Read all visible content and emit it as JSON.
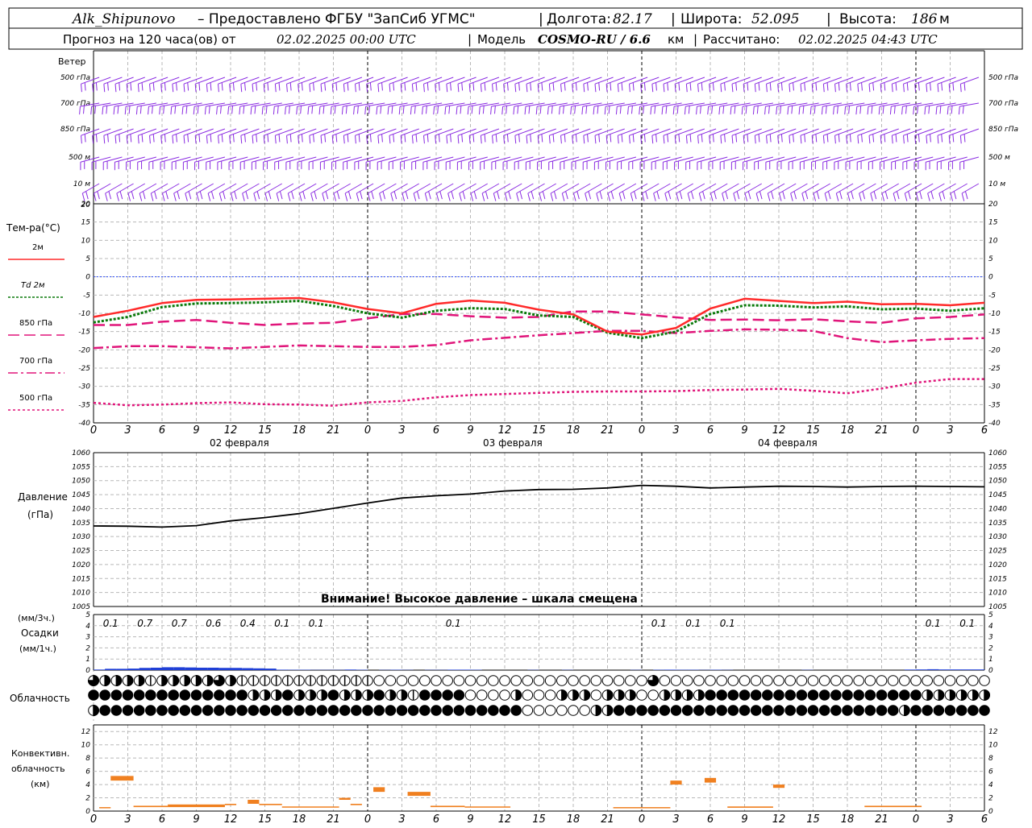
{
  "header": {
    "station": "Alk_Shipunovo",
    "provider": "– Предоставлено ФГБУ \"ЗапСиб УГМС\"",
    "lon_label": "Долгота:",
    "lon_value": "82.17",
    "lat_label": "Широта:",
    "lat_value": "52.095",
    "alt_label": "Высота:",
    "alt_value": "186",
    "alt_unit": "м",
    "forecast_label": "Прогноз на 120 часа(ов) от",
    "forecast_from": "02.02.2025 00:00 UTC",
    "model_label": "Модель",
    "model_name": "COSMO-RU / 6.6",
    "model_unit": "км",
    "calc_label": "Рассчитано:",
    "calc_time": "02.02.2025 04:43 UTC"
  },
  "labels": {
    "wind": "Ветер",
    "wind_levels": [
      "500 гПа",
      "700 гПа",
      "850 гПа",
      "500 м",
      "10   м"
    ],
    "temp_title": "Тем-ра(°С)",
    "temp_legend": [
      "2м",
      "Td  2м",
      "850 гПа",
      "700 гПа",
      "500 гПа"
    ],
    "pressure_title": "Давление",
    "pressure_unit": "(гПа)",
    "pressure_warning": "Внимание! Высокое давление – шкала смещена",
    "precip_unit3": "(мм/3ч.)",
    "precip_title": "Осадки",
    "precip_unit1": "(мм/1ч.)",
    "cloud_title": "Облачность",
    "conv_title1": "Конвективн.",
    "conv_title2": "облачность",
    "conv_unit": "(км)",
    "dates": [
      "02 февраля",
      "03 февраля",
      "04 февраля"
    ]
  },
  "colors": {
    "t2m": "#ff2a2a",
    "td2m": "#0a7a0a",
    "p850": "#e0157a",
    "p700": "#e0157a",
    "p500": "#e0157a",
    "wind": "#8a2be2",
    "precip": "#1f3fd6",
    "conv": "#f08020",
    "pressure": "#000000",
    "zero": "#3050ff"
  },
  "chart_data": [
    {
      "type": "line",
      "name": "temperature",
      "x_hours": [
        0,
        3,
        6,
        9,
        12,
        15,
        18,
        21,
        24,
        27,
        30,
        33,
        36,
        39,
        42,
        45,
        48,
        51,
        54,
        57,
        60,
        63,
        66,
        69,
        72,
        75,
        78
      ],
      "xticks": [
        "0",
        "3",
        "6",
        "9",
        "12",
        "15",
        "18",
        "21",
        "0",
        "3",
        "6",
        "9",
        "12",
        "15",
        "18",
        "21",
        "0",
        "3",
        "6",
        "9",
        "12",
        "15",
        "18",
        "21",
        "0",
        "3",
        "6"
      ],
      "ylim": [
        -40,
        20
      ],
      "yticks": [
        20,
        15,
        10,
        5,
        0,
        -5,
        -10,
        -15,
        -20,
        -25,
        -30,
        -35,
        -40
      ],
      "series": [
        {
          "name": "2м",
          "values": [
            -11,
            -9.3,
            -7.2,
            -6.3,
            -6.2,
            -6.0,
            -5.8,
            -7.0,
            -8.8,
            -10,
            -7.4,
            -6.5,
            -7.1,
            -9.0,
            -10.3,
            -15.0,
            -15.8,
            -14.0,
            -8.7,
            -6.0,
            -6.6,
            -7.2,
            -6.8,
            -7.5,
            -7.4,
            -7.8,
            -7.1
          ]
        },
        {
          "name": "Td  2м",
          "values": [
            -12.5,
            -11,
            -8.3,
            -7.3,
            -7.2,
            -7.0,
            -6.6,
            -8.0,
            -10.0,
            -11.2,
            -9.3,
            -8.6,
            -8.8,
            -10.6,
            -11.0,
            -15.3,
            -16.8,
            -15.0,
            -10.2,
            -7.8,
            -7.9,
            -8.4,
            -8.1,
            -8.9,
            -8.7,
            -9.3,
            -8.6
          ]
        },
        {
          "name": "850 гПа",
          "values": [
            -13.2,
            -13.2,
            -12.3,
            -11.8,
            -12.6,
            -13.2,
            -12.8,
            -12.6,
            -11.4,
            -10.2,
            -10.2,
            -10.8,
            -11.2,
            -11.0,
            -9.5,
            -9.5,
            -10.3,
            -11.1,
            -11.8,
            -11.7,
            -11.9,
            -11.6,
            -12.2,
            -12.6,
            -11.4,
            -11.0,
            -10.3
          ]
        },
        {
          "name": "700 гПа",
          "values": [
            -19.5,
            -19.0,
            -19.0,
            -19.3,
            -19.6,
            -19.2,
            -18.8,
            -19.0,
            -19.2,
            -19.2,
            -18.7,
            -17.4,
            -16.7,
            -16.0,
            -15.4,
            -14.8,
            -14.8,
            -15.4,
            -14.8,
            -14.4,
            -14.5,
            -14.8,
            -16.8,
            -17.9,
            -17.4,
            -17.0,
            -16.8
          ]
        },
        {
          "name": "500 гПа",
          "values": [
            -34.5,
            -35.2,
            -35.0,
            -34.6,
            -34.4,
            -34.9,
            -35.0,
            -35.3,
            -34.4,
            -34.0,
            -33.0,
            -32.4,
            -32.1,
            -31.8,
            -31.5,
            -31.4,
            -31.4,
            -31.3,
            -31.0,
            -30.9,
            -30.7,
            -31.2,
            -31.9,
            -30.6,
            -29.0,
            -28.0,
            -28.0
          ]
        }
      ]
    },
    {
      "type": "line",
      "name": "pressure",
      "x_hours": [
        0,
        3,
        6,
        9,
        12,
        15,
        18,
        21,
        24,
        27,
        30,
        33,
        36,
        39,
        42,
        45,
        48,
        51,
        54,
        57,
        60,
        63,
        66,
        69,
        72,
        75,
        78
      ],
      "ylim": [
        1005,
        1060
      ],
      "yticks": [
        1060,
        1055,
        1050,
        1045,
        1040,
        1035,
        1030,
        1025,
        1020,
        1015,
        1010,
        1005
      ],
      "series": [
        {
          "name": "Давление",
          "values": [
            1033.8,
            1033.7,
            1033.4,
            1033.9,
            1035.6,
            1036.8,
            1038.2,
            1040.1,
            1042.0,
            1043.8,
            1044.6,
            1045.2,
            1046.3,
            1046.8,
            1046.9,
            1047.4,
            1048.3,
            1048.0,
            1047.4,
            1047.7,
            1048.0,
            1047.9,
            1047.7,
            1047.9,
            1048.0,
            1047.9,
            1047.8
          ]
        }
      ]
    },
    {
      "type": "bar",
      "name": "precipitation",
      "ylim": [
        0,
        5
      ],
      "yticks": [
        5,
        4,
        3,
        2,
        1,
        0
      ],
      "totals_3h": [
        {
          "x": 1.5,
          "label": "0.1"
        },
        {
          "x": 4.5,
          "label": "0.7"
        },
        {
          "x": 7.5,
          "label": "0.7"
        },
        {
          "x": 10.5,
          "label": "0.6"
        },
        {
          "x": 13.5,
          "label": "0.4"
        },
        {
          "x": 16.5,
          "label": "0.1"
        },
        {
          "x": 19.5,
          "label": "0.1"
        },
        {
          "x": 31.5,
          "label": "0.1"
        },
        {
          "x": 49.5,
          "label": "0.1"
        },
        {
          "x": 52.5,
          "label": "0.1"
        },
        {
          "x": 55.5,
          "label": "0.1"
        },
        {
          "x": 73.5,
          "label": "0.1"
        },
        {
          "x": 76.5,
          "label": "0.1"
        }
      ],
      "hourly": [
        0.05,
        0.12,
        0.12,
        0.14,
        0.2,
        0.22,
        0.26,
        0.26,
        0.24,
        0.22,
        0.22,
        0.2,
        0.2,
        0.18,
        0.16,
        0.14,
        0.04,
        0.03,
        0.03,
        0.02,
        0.02,
        0.02,
        0.05,
        0.03,
        0.0,
        0.02,
        0.03,
        0.02,
        0.0,
        0.02,
        0.02,
        0.04,
        0.04,
        0.03,
        0.0,
        0.0,
        0.0,
        0.0,
        0.02,
        0.0,
        0.0,
        0.02,
        0.0,
        0.0,
        0.0,
        0.0,
        0.0,
        0.02,
        0.0,
        0.03,
        0.04,
        0.03,
        0.03,
        0.02,
        0.03,
        0.02,
        0.0,
        0.0,
        0.0,
        0.0,
        0.0,
        0.0,
        0.02,
        0.0,
        0.0,
        0.0,
        0.0,
        0.0,
        0.0,
        0.0,
        0.0,
        0.05,
        0.06,
        0.08,
        0.06,
        0.06,
        0.06,
        0.06
      ]
    },
    {
      "type": "bar",
      "name": "convective_cloud",
      "ylim": [
        0,
        13
      ],
      "yticks": [
        12,
        10,
        8,
        6,
        4,
        2,
        0
      ],
      "segments": [
        {
          "x0": 0.5,
          "x1": 1.5,
          "bottom": 0.5,
          "top": 0.6
        },
        {
          "x0": 1.5,
          "x1": 3.5,
          "bottom": 4.6,
          "top": 5.3
        },
        {
          "x0": 3.5,
          "x1": 6.5,
          "bottom": 0.6,
          "top": 0.8
        },
        {
          "x0": 6.5,
          "x1": 11.5,
          "bottom": 0.6,
          "top": 1.0
        },
        {
          "x0": 11.5,
          "x1": 12.5,
          "bottom": 0.9,
          "top": 1.1
        },
        {
          "x0": 13.5,
          "x1": 14.5,
          "bottom": 1.1,
          "top": 1.7
        },
        {
          "x0": 14.5,
          "x1": 16.5,
          "bottom": 0.9,
          "top": 1.1
        },
        {
          "x0": 16.5,
          "x1": 21.5,
          "bottom": 0.6,
          "top": 0.7
        },
        {
          "x0": 21.5,
          "x1": 22.5,
          "bottom": 1.7,
          "top": 2.0
        },
        {
          "x0": 22.5,
          "x1": 23.5,
          "bottom": 0.9,
          "top": 1.1
        },
        {
          "x0": 24.5,
          "x1": 25.5,
          "bottom": 2.9,
          "top": 3.6
        },
        {
          "x0": 27.5,
          "x1": 29.5,
          "bottom": 2.3,
          "top": 2.9
        },
        {
          "x0": 29.5,
          "x1": 32.5,
          "bottom": 0.6,
          "top": 0.8
        },
        {
          "x0": 32.5,
          "x1": 36.5,
          "bottom": 0.6,
          "top": 0.7
        },
        {
          "x0": 45.5,
          "x1": 50.5,
          "bottom": 0.5,
          "top": 0.6
        },
        {
          "x0": 50.5,
          "x1": 51.5,
          "bottom": 4.0,
          "top": 4.6
        },
        {
          "x0": 53.5,
          "x1": 54.5,
          "bottom": 4.3,
          "top": 5.0
        },
        {
          "x0": 55.5,
          "x1": 59.5,
          "bottom": 0.5,
          "top": 0.7
        },
        {
          "x0": 59.5,
          "x1": 60.5,
          "bottom": 3.5,
          "top": 4.0
        },
        {
          "x0": 67.5,
          "x1": 72.5,
          "bottom": 0.6,
          "top": 0.8
        }
      ]
    },
    {
      "type": "table",
      "name": "cloudiness",
      "rows": [
        "bhhhhihhhhhbhiiiiiiiiiiiioooooooooooooooooooooooobooooooooooooooooooooooooooooooooooooooooooooooooooooo",
        "ffffffffffffffhhhfhhhfhhhfhhiffffoooohooohhhohhhoohhhhfffffffffffffffffffhhhhhhhhhhhoooofooooo",
        "hfffffffffffffffffffffffffffffffffffffoooooohhfffffffffffffffffffffffffhfffffffffff"
      ]
    },
    {
      "type": "scatter",
      "name": "wind_barbs",
      "levels": [
        "500 гПа",
        "700 гПа",
        "850 гПа",
        "500 м",
        "10   м"
      ],
      "direction_deg": [
        [
          250,
          250,
          250,
          250,
          250,
          250,
          250,
          250,
          250,
          250,
          250,
          250,
          250,
          250,
          250,
          250,
          250,
          250,
          250,
          250,
          250,
          250,
          250,
          250,
          250,
          250,
          250,
          250,
          250,
          250,
          250,
          250,
          250,
          250,
          250,
          250,
          250,
          250,
          250,
          250,
          250,
          250,
          250,
          250,
          250,
          250,
          250,
          250,
          250,
          250,
          250,
          250,
          250,
          250,
          250,
          250,
          250,
          250,
          250,
          250,
          250,
          250,
          250,
          250,
          250,
          250,
          250,
          250,
          250,
          250,
          250,
          250,
          250,
          250,
          250,
          250,
          250,
          250
        ],
        [
          260,
          260,
          260,
          260,
          260,
          260,
          260,
          260,
          260,
          260,
          260,
          260,
          260,
          260,
          260,
          260,
          260,
          260,
          260,
          260,
          260,
          260,
          260,
          260,
          260,
          260,
          260,
          260,
          260,
          260,
          260,
          260,
          260,
          260,
          260,
          260,
          260,
          260,
          260,
          260,
          260,
          260,
          260,
          260,
          260,
          260,
          260,
          260,
          260,
          260,
          260,
          260,
          260,
          260,
          260,
          260,
          260,
          260,
          260,
          260,
          260,
          260,
          260,
          260,
          260,
          260,
          260,
          260,
          260,
          260,
          260,
          260,
          260,
          260,
          260,
          260,
          260,
          260
        ],
        [
          250,
          250,
          250,
          250,
          250,
          250,
          250,
          250,
          250,
          250,
          250,
          250,
          250,
          250,
          250,
          250,
          250,
          250,
          250,
          250,
          250,
          250,
          250,
          250,
          250,
          250,
          250,
          250,
          250,
          250,
          250,
          250,
          250,
          250,
          250,
          250,
          250,
          250,
          250,
          250,
          250,
          250,
          250,
          250,
          250,
          250,
          250,
          250,
          250,
          250,
          250,
          250,
          250,
          250,
          250,
          250,
          250,
          250,
          250,
          250,
          250,
          250,
          250,
          250,
          250,
          250,
          250,
          250,
          250,
          250,
          250,
          250,
          250,
          250,
          250,
          250,
          250,
          250
        ],
        [
          255,
          255,
          255,
          255,
          255,
          255,
          255,
          255,
          255,
          255,
          255,
          255,
          255,
          255,
          255,
          255,
          255,
          255,
          255,
          255,
          255,
          255,
          255,
          255,
          255,
          255,
          255,
          255,
          255,
          255,
          255,
          255,
          255,
          255,
          255,
          255,
          255,
          255,
          255,
          255,
          255,
          255,
          255,
          255,
          255,
          255,
          255,
          255,
          255,
          255,
          255,
          255,
          255,
          255,
          255,
          255,
          255,
          255,
          255,
          255,
          255,
          255,
          255,
          255,
          255,
          255,
          255,
          255,
          255,
          255,
          255,
          255,
          255,
          255,
          255,
          255,
          255,
          255
        ],
        [
          240,
          240,
          240,
          240,
          240,
          240,
          240,
          240,
          240,
          240,
          240,
          240,
          240,
          240,
          240,
          240,
          240,
          240,
          240,
          240,
          240,
          240,
          240,
          240,
          240,
          240,
          240,
          240,
          240,
          240,
          240,
          240,
          240,
          240,
          240,
          240,
          240,
          240,
          240,
          240,
          240,
          240,
          240,
          240,
          240,
          240,
          240,
          240,
          240,
          240,
          240,
          240,
          240,
          240,
          240,
          240,
          240,
          240,
          240,
          240,
          240,
          240,
          240,
          240,
          240,
          240,
          240,
          240,
          240,
          240,
          240,
          240,
          240,
          240,
          240,
          240,
          240,
          240
        ]
      ]
    }
  ]
}
